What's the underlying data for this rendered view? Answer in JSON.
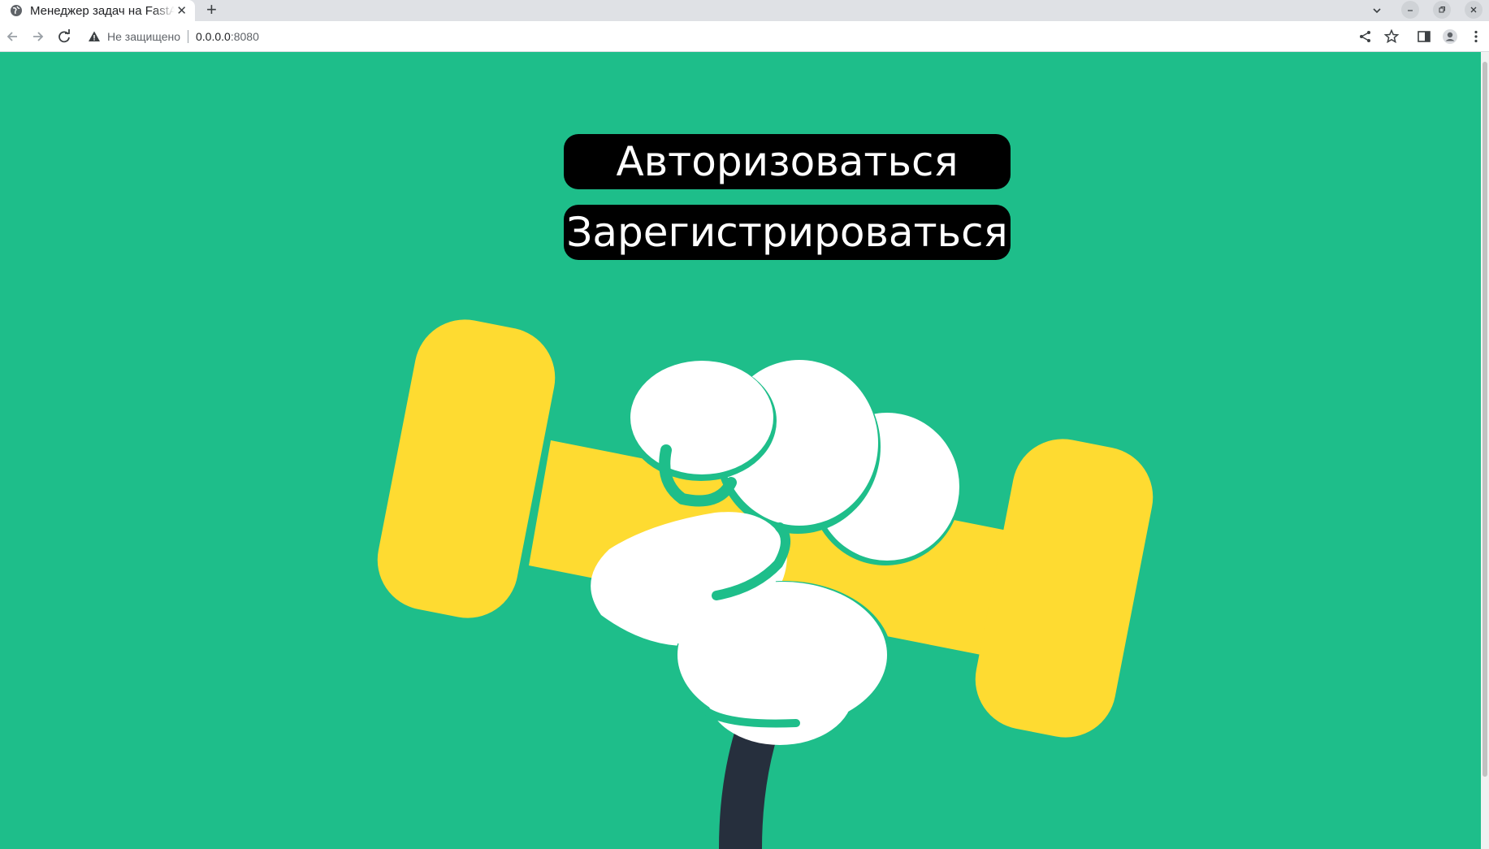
{
  "browser": {
    "tab_title": "Менеджер задач на FastAPI",
    "new_tab_label": "+",
    "security_label": "Не защищено",
    "url_host": "0.0.0.0",
    "url_port": ":8080"
  },
  "page": {
    "login_button": "Авторизоваться",
    "register_button": "Зарегистрироваться"
  },
  "colors": {
    "background": "#1ebe8a",
    "button": "#000000",
    "dumbbell": "#fedb31",
    "fist": "#ffffff",
    "arm": "#262f3d"
  }
}
